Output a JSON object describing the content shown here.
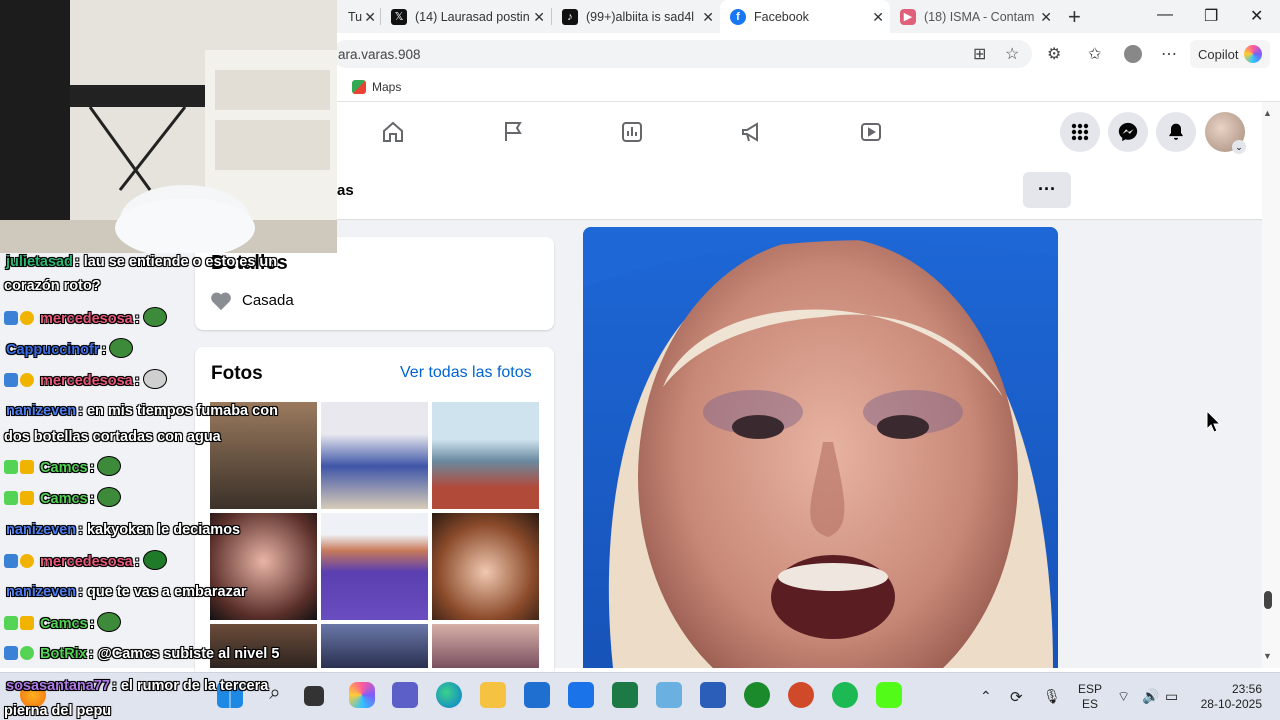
{
  "browser": {
    "tabs": [
      {
        "label": "(14) Laurasad postin",
        "icon": "x-logo-icon"
      },
      {
        "label": "(99+)albiita is sad4l",
        "icon": "tiktok-icon"
      },
      {
        "label": "Facebook",
        "icon": "facebook-icon",
        "active": true
      },
      {
        "label": "(18) ISMA - Contam",
        "icon": "youtube-icon"
      }
    ],
    "partial_tab_label": "Tu",
    "url": "ara.varas.908",
    "favorites": [
      {
        "label": "Maps",
        "icon": "maps-icon"
      }
    ],
    "copilot_label": "Copilot"
  },
  "facebook": {
    "profile_name_partial": "as",
    "details": {
      "title": "Detalles",
      "status": "Casada"
    },
    "photos": {
      "title": "Fotos",
      "see_all": "Ver todas las fotos"
    }
  },
  "chat": [
    {
      "user": "julietasad",
      "user_color": "#2bb673",
      "message": "lau se entiende o esto es un"
    },
    {
      "user": "",
      "user_color": "#ffffff",
      "message": "corazón roto?"
    },
    {
      "user": "mercedesosa",
      "user_color": "#e9587a",
      "message": "",
      "emote": "pepe"
    },
    {
      "user": "Cappuccinofr",
      "user_color": "#3a6ee8",
      "message": "",
      "emote": "pepe"
    },
    {
      "user": "mercedesosa",
      "user_color": "#e9587a",
      "message": "",
      "emote": "face"
    },
    {
      "user": "nanizeven",
      "user_color": "#4d7df0",
      "message": "en mis tiempos fumaba con"
    },
    {
      "user": "",
      "user_color": "#ffffff",
      "message": "dos botellas cortadas con agua"
    },
    {
      "user": "Camcs",
      "user_color": "#54d354",
      "message": "",
      "emote": "pepe"
    },
    {
      "user": "Camcs",
      "user_color": "#54d354",
      "message": "",
      "emote": "pepe"
    },
    {
      "user": "nanizeven",
      "user_color": "#4d7df0",
      "message": "kakyoken le deciamos"
    },
    {
      "user": "mercedesosa",
      "user_color": "#e9587a",
      "message": "",
      "emote": "pepe"
    },
    {
      "user": "nanizeven",
      "user_color": "#4d7df0",
      "message": "que te vas a embarazar"
    },
    {
      "user": "Camcs",
      "user_color": "#54d354",
      "message": "",
      "emote": "pepe"
    },
    {
      "user": "BotRix",
      "user_color": "#54d354",
      "message": "@Camcs subiste al nivel 5"
    },
    {
      "user": "sosasantana77",
      "user_color": "#b07ae8",
      "message": "el rumor de la tercera"
    },
    {
      "user": "",
      "user_color": "#ffffff",
      "message": "pierna del pepu"
    }
  ],
  "taskbar": {
    "lang_top": "ESP",
    "lang_bottom": "ES",
    "time": "23:56",
    "date": "28-10-2025"
  },
  "colors": {
    "fb_blue": "#0064d1",
    "fb_bg": "#f0f2f5",
    "photo_bg": "#1d67d6"
  }
}
